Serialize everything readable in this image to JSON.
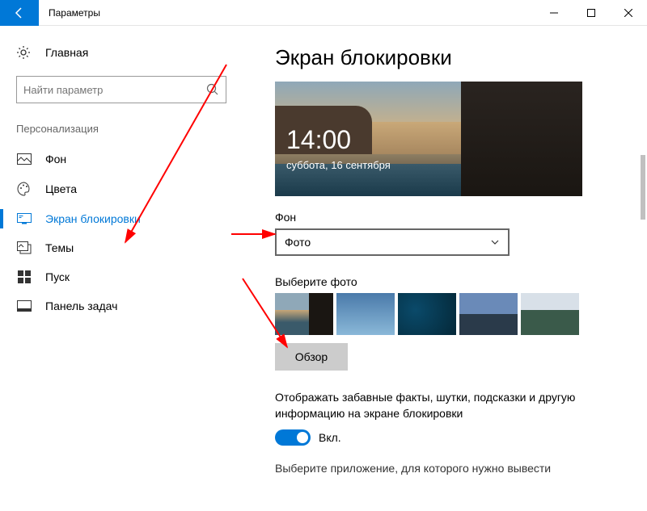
{
  "window": {
    "title": "Параметры"
  },
  "sidebar": {
    "home": "Главная",
    "search_placeholder": "Найти параметр",
    "section": "Персонализация",
    "items": [
      {
        "label": "Фон"
      },
      {
        "label": "Цвета"
      },
      {
        "label": "Экран блокировки"
      },
      {
        "label": "Темы"
      },
      {
        "label": "Пуск"
      },
      {
        "label": "Панель задач"
      }
    ]
  },
  "main": {
    "title": "Экран блокировки",
    "preview": {
      "time": "14:00",
      "date": "суббота, 16 сентября"
    },
    "background_label": "Фон",
    "background_value": "Фото",
    "choose_label": "Выберите фото",
    "browse": "Обзор",
    "toggle_desc": "Отображать забавные факты, шутки, подсказки и другую информацию на экране блокировки",
    "toggle_state": "Вкл.",
    "footer": "Выберите приложение, для которого нужно вывести"
  }
}
